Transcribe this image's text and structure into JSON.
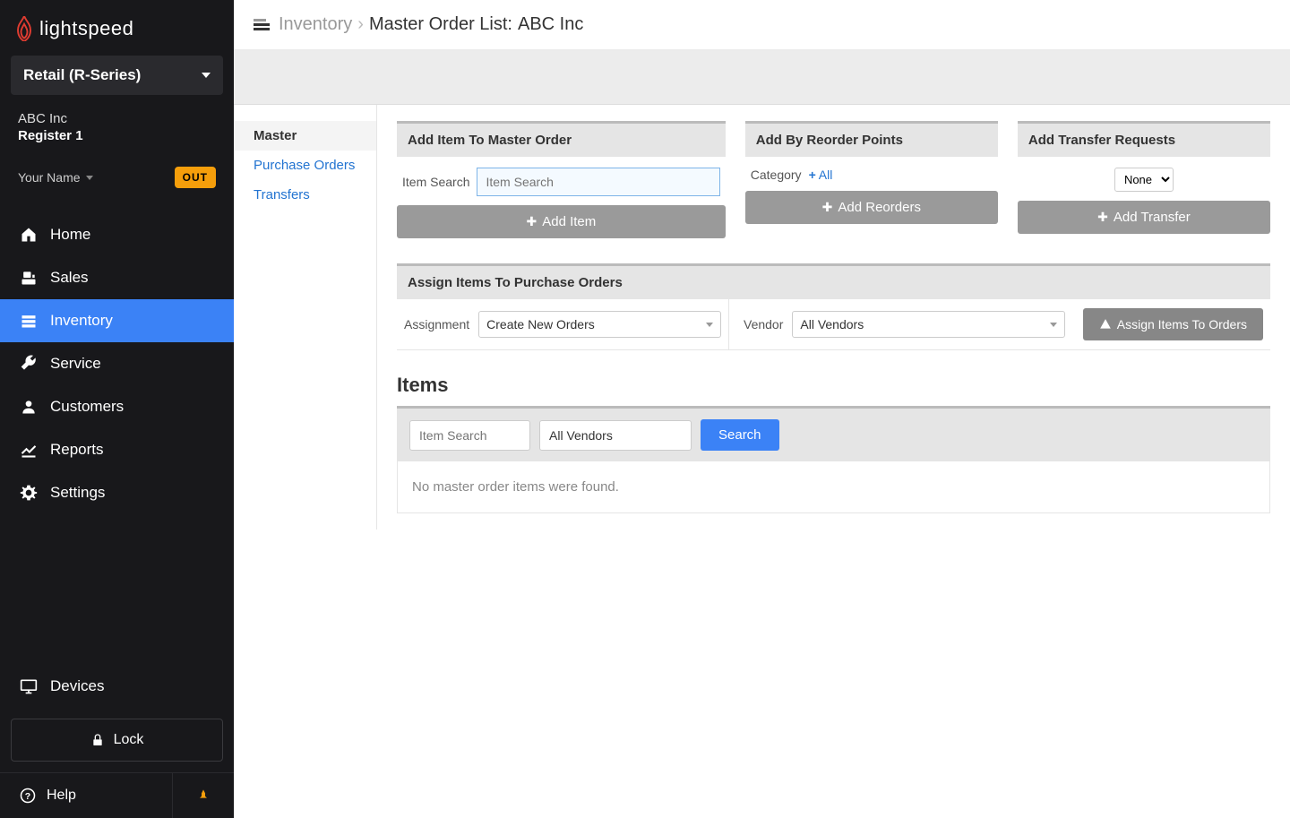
{
  "brand": "lightspeed",
  "product_switcher": "Retail (R-Series)",
  "company": {
    "name": "ABC Inc",
    "register": "Register 1"
  },
  "user": {
    "label": "Your Name",
    "status": "OUT"
  },
  "nav": {
    "home": "Home",
    "sales": "Sales",
    "inventory": "Inventory",
    "service": "Service",
    "customers": "Customers",
    "reports": "Reports",
    "settings": "Settings",
    "devices": "Devices",
    "lock": "Lock",
    "help": "Help"
  },
  "breadcrumb": {
    "section": "Inventory",
    "page": "Master Order List:",
    "entity": "ABC Inc"
  },
  "subnav": {
    "master": "Master",
    "po": "Purchase Orders",
    "transfers": "Transfers"
  },
  "panels": {
    "add_item": {
      "title": "Add Item To Master Order",
      "label": "Item Search",
      "placeholder": "Item Search",
      "btn": "Add Item"
    },
    "reorder": {
      "title": "Add By Reorder Points",
      "label": "Category",
      "all": "All",
      "btn": "Add Reorders"
    },
    "transfer": {
      "title": "Add Transfer Requests",
      "select": "None",
      "btn": "Add Transfer"
    },
    "assign": {
      "title": "Assign Items To Purchase Orders",
      "assignment_label": "Assignment",
      "assignment_value": "Create New Orders",
      "vendor_label": "Vendor",
      "vendor_value": "All Vendors",
      "btn": "Assign Items To Orders"
    }
  },
  "items": {
    "heading": "Items",
    "search_placeholder": "Item Search",
    "vendor_value": "All Vendors",
    "search_btn": "Search",
    "empty": "No master order items were found."
  }
}
